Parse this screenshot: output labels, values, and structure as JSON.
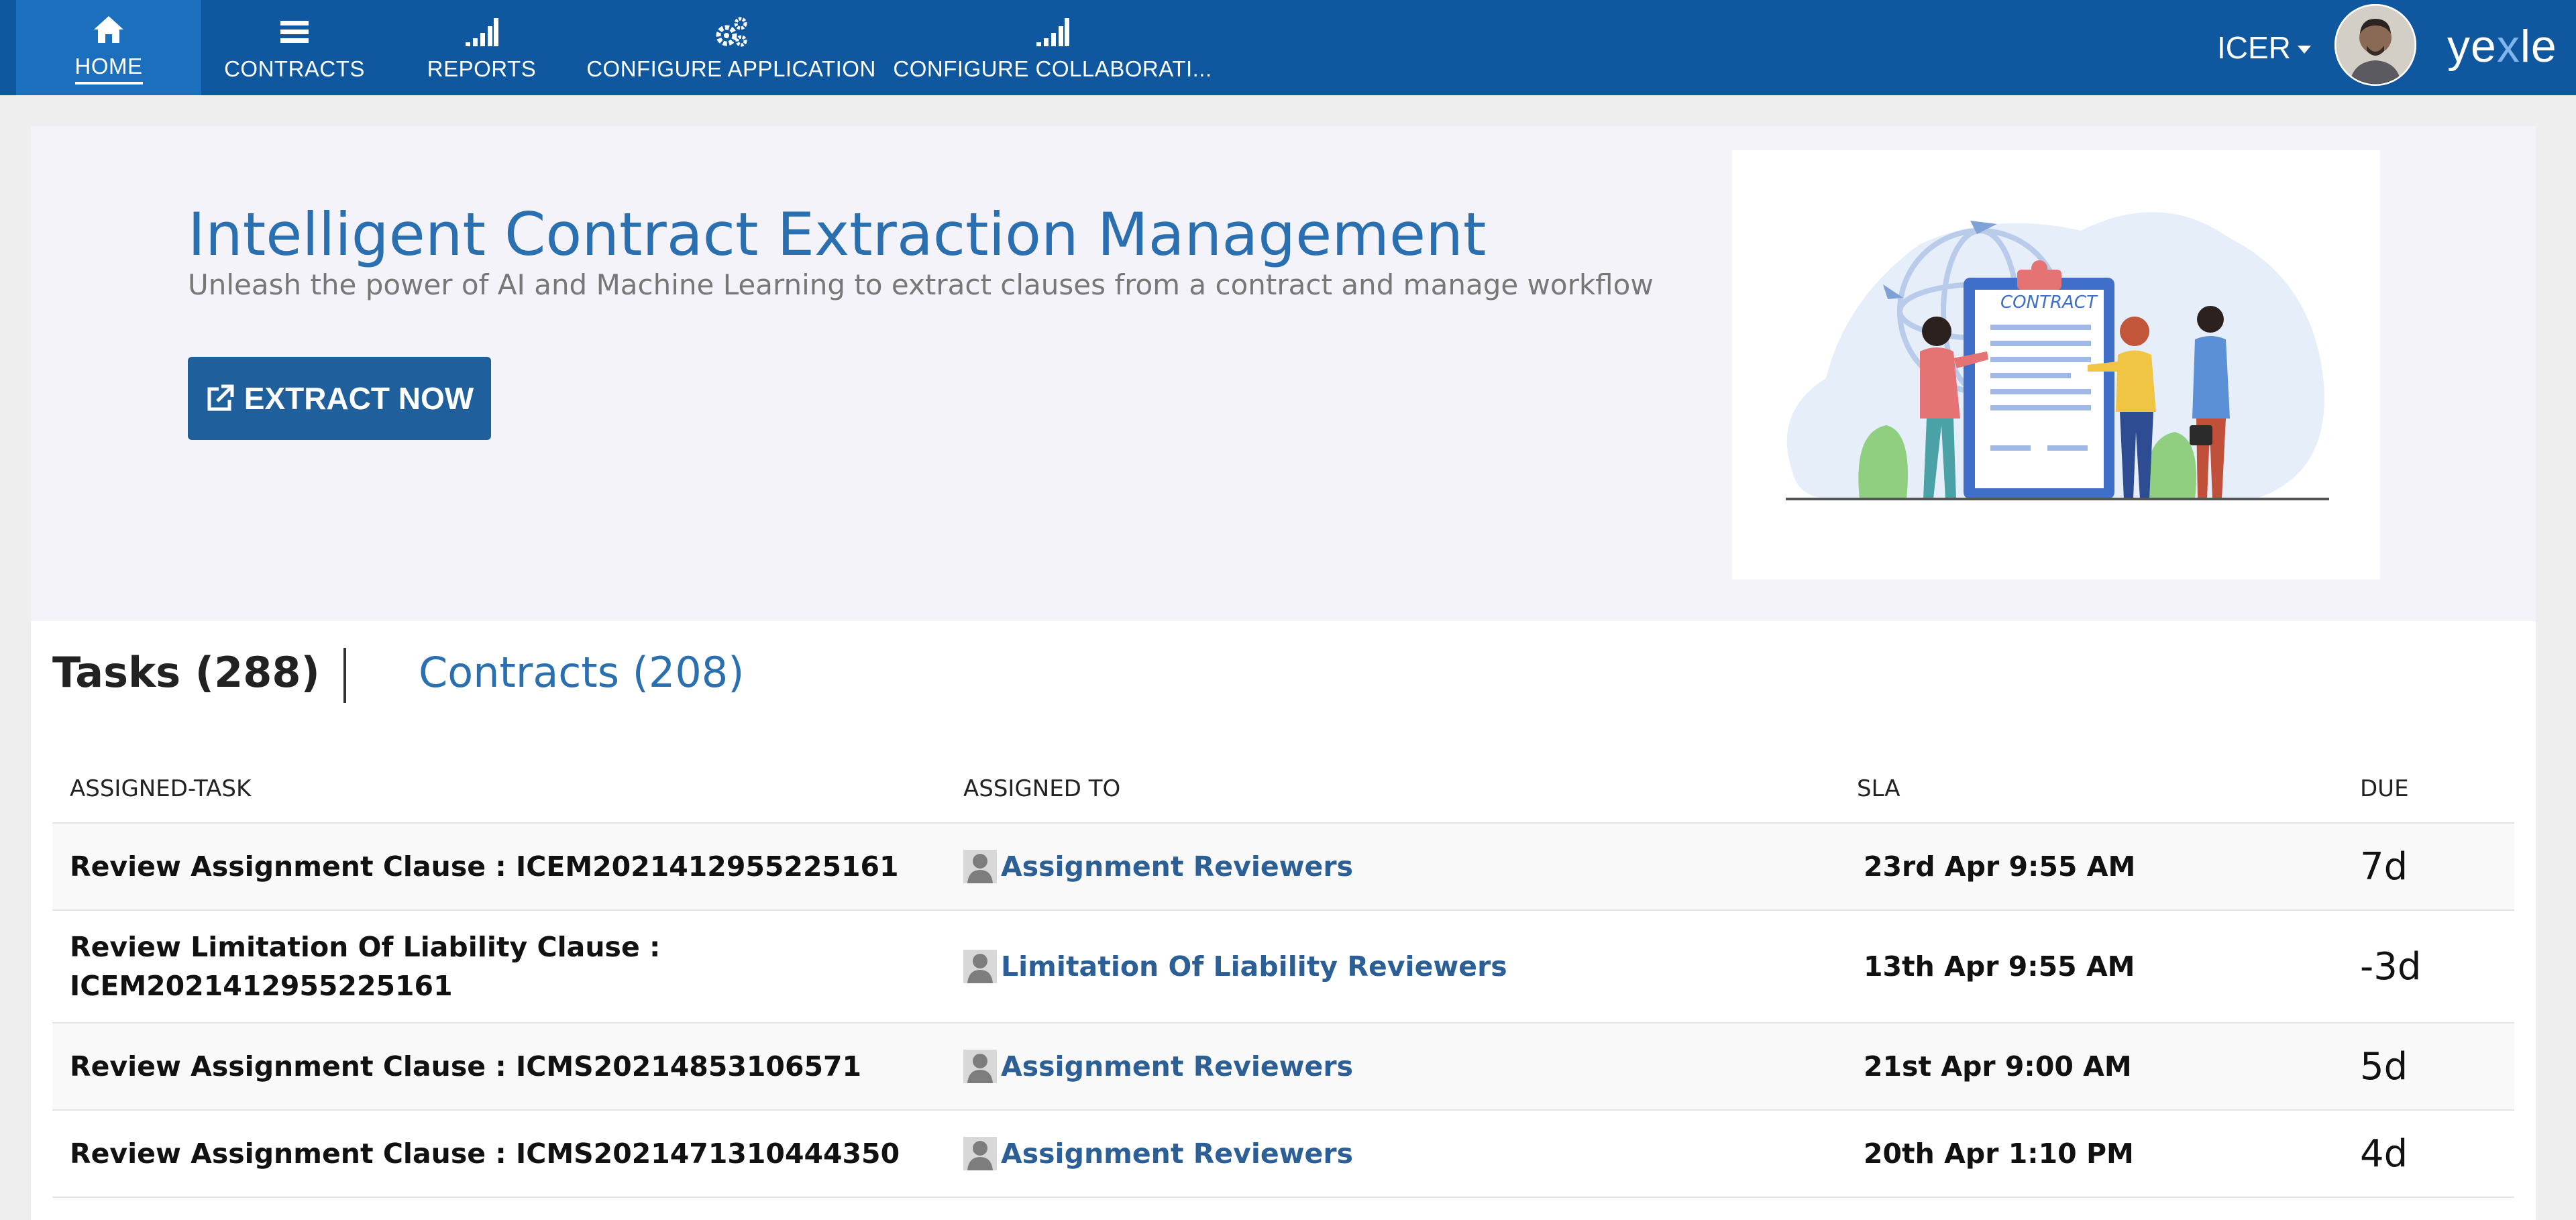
{
  "nav": {
    "items": [
      {
        "label": "HOME",
        "icon": "home-icon",
        "active": true
      },
      {
        "label": "CONTRACTS",
        "icon": "menu-icon"
      },
      {
        "label": "REPORTS",
        "icon": "signal-bars-icon"
      },
      {
        "label": "CONFIGURE APPLICATION",
        "icon": "gears-icon"
      },
      {
        "label": "CONFIGURE COLLABORATI...",
        "icon": "signal-bars-icon"
      }
    ],
    "user": "ICER",
    "logo_prefix": "ye",
    "logo_x": "x",
    "logo_suffix": "le"
  },
  "hero": {
    "title": "Intelligent Contract Extraction Management",
    "subtitle": "Unleash the power of AI and Machine Learning to extract clauses from a contract and manage workflow",
    "button": "EXTRACT NOW",
    "illustration_text": "CONTRACT"
  },
  "tabs": {
    "tasks": "Tasks (288)",
    "contracts": "Contracts (208)"
  },
  "table": {
    "headers": [
      "ASSIGNED-TASK",
      "ASSIGNED TO",
      "SLA",
      "DUE"
    ],
    "rows": [
      {
        "task": "Review Assignment Clause  : ICEM2021412955225161",
        "assignee": "Assignment Reviewers",
        "sla": "23rd Apr 9:55 AM",
        "due": "7d"
      },
      {
        "task": "Review Limitation Of Liability Clause  : ICEM2021412955225161",
        "assignee": "Limitation Of Liability Reviewers",
        "sla": "13th Apr 9:55 AM",
        "due": "-3d"
      },
      {
        "task": "Review Assignment Clause  : ICMS20214853106571",
        "assignee": "Assignment Reviewers",
        "sla": "21st Apr 9:00 AM",
        "due": "5d"
      },
      {
        "task": "Review Assignment Clause  : ICMS2021471310444350",
        "assignee": "Assignment Reviewers",
        "sla": "20th Apr 1:10 PM",
        "due": "4d"
      }
    ]
  },
  "colors": {
    "topbar": "#0f58a0",
    "accent": "#2a6fb0",
    "due_positive": "#2eab2e",
    "due_negative": "#cc1f3c"
  }
}
